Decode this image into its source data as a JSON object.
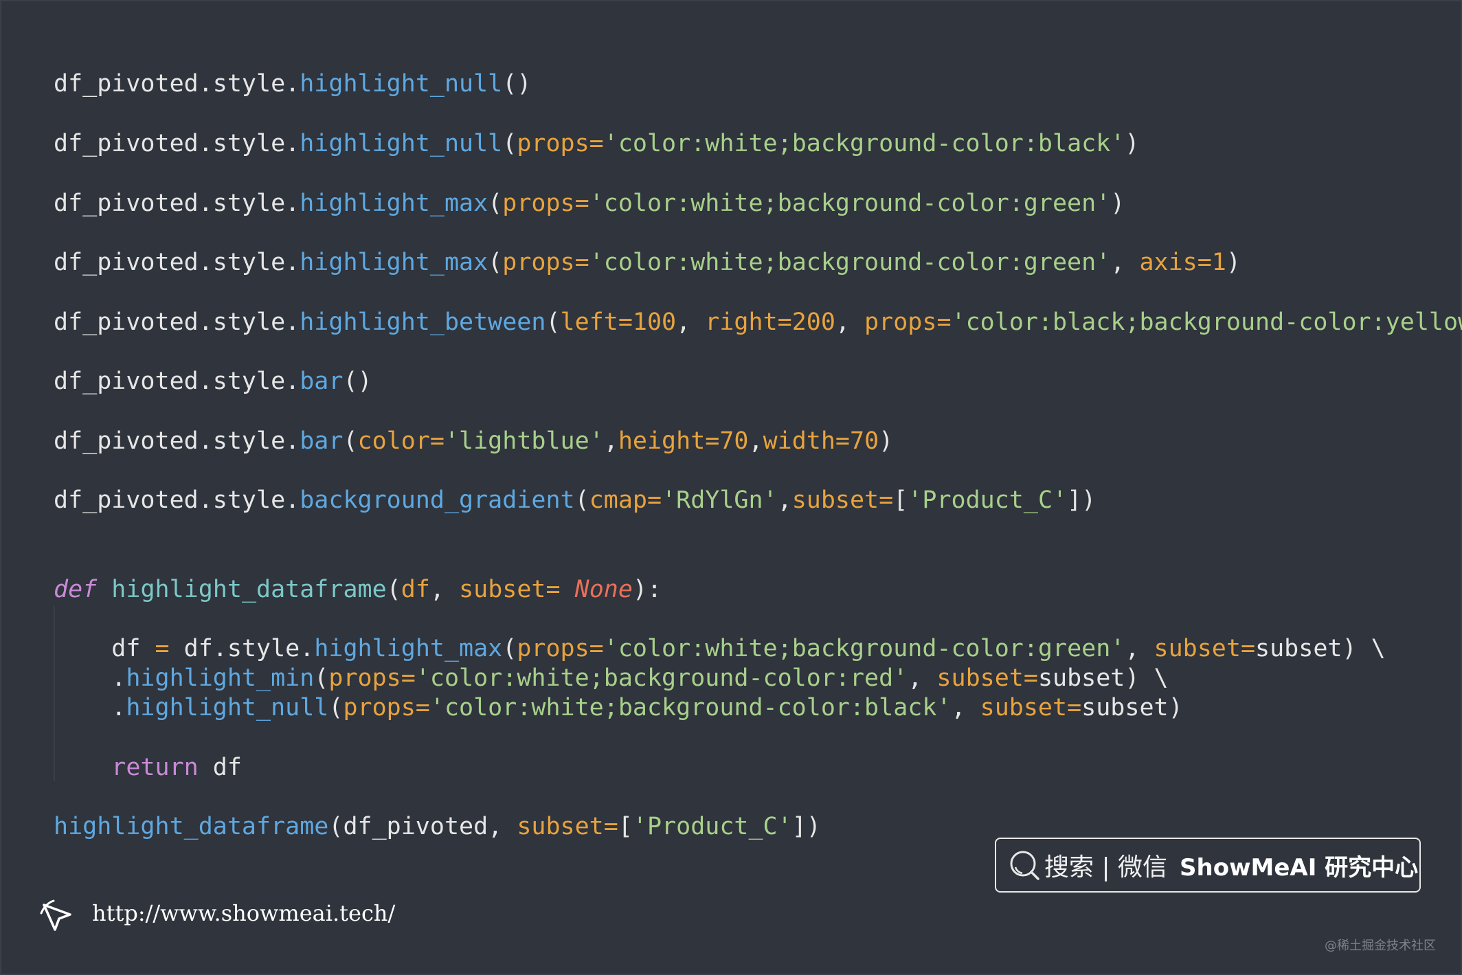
{
  "code_lines": [
    [
      {
        "t": "df_pivoted.style.",
        "c": "plain"
      },
      {
        "t": "highlight_null",
        "c": "fn"
      },
      {
        "t": "()",
        "c": "plain"
      }
    ],
    [
      {
        "t": "df_pivoted.style.",
        "c": "plain"
      },
      {
        "t": "highlight_null",
        "c": "fn"
      },
      {
        "t": "(",
        "c": "plain"
      },
      {
        "t": "props=",
        "c": "param"
      },
      {
        "t": "'color:white;background-color:black'",
        "c": "str"
      },
      {
        "t": ")",
        "c": "plain"
      }
    ],
    [
      {
        "t": "df_pivoted.style.",
        "c": "plain"
      },
      {
        "t": "highlight_max",
        "c": "fn"
      },
      {
        "t": "(",
        "c": "plain"
      },
      {
        "t": "props=",
        "c": "param"
      },
      {
        "t": "'color:white;background-color:green'",
        "c": "str"
      },
      {
        "t": ")",
        "c": "plain"
      }
    ],
    [
      {
        "t": "df_pivoted.style.",
        "c": "plain"
      },
      {
        "t": "highlight_max",
        "c": "fn"
      },
      {
        "t": "(",
        "c": "plain"
      },
      {
        "t": "props=",
        "c": "param"
      },
      {
        "t": "'color:white;background-color:green'",
        "c": "str"
      },
      {
        "t": ", ",
        "c": "plain"
      },
      {
        "t": "axis=1",
        "c": "param"
      },
      {
        "t": ")",
        "c": "plain"
      }
    ],
    [
      {
        "t": "df_pivoted.style.",
        "c": "plain"
      },
      {
        "t": "highlight_between",
        "c": "fn"
      },
      {
        "t": "(",
        "c": "plain"
      },
      {
        "t": "left=100",
        "c": "param"
      },
      {
        "t": ", ",
        "c": "plain"
      },
      {
        "t": "right=200",
        "c": "param"
      },
      {
        "t": ", ",
        "c": "plain"
      },
      {
        "t": "props=",
        "c": "param"
      },
      {
        "t": "'color:black;background-color:yellow'",
        "c": "str"
      },
      {
        "t": ")",
        "c": "plain"
      }
    ],
    [
      {
        "t": "df_pivoted.style.",
        "c": "plain"
      },
      {
        "t": "bar",
        "c": "fn"
      },
      {
        "t": "()",
        "c": "plain"
      }
    ],
    [
      {
        "t": "df_pivoted.style.",
        "c": "plain"
      },
      {
        "t": "bar",
        "c": "fn"
      },
      {
        "t": "(",
        "c": "plain"
      },
      {
        "t": "color=",
        "c": "param"
      },
      {
        "t": "'lightblue'",
        "c": "str"
      },
      {
        "t": ",",
        "c": "plain"
      },
      {
        "t": "height=70",
        "c": "param"
      },
      {
        "t": ",",
        "c": "plain"
      },
      {
        "t": "width=70",
        "c": "param"
      },
      {
        "t": ")",
        "c": "plain"
      }
    ],
    [
      {
        "t": "df_pivoted.style.",
        "c": "plain"
      },
      {
        "t": "background_gradient",
        "c": "fn"
      },
      {
        "t": "(",
        "c": "plain"
      },
      {
        "t": "cmap=",
        "c": "param"
      },
      {
        "t": "'RdYlGn'",
        "c": "str"
      },
      {
        "t": ",",
        "c": "plain"
      },
      {
        "t": "subset=",
        "c": "param"
      },
      {
        "t": "[",
        "c": "plain"
      },
      {
        "t": "'Product_C'",
        "c": "str"
      },
      {
        "t": "])",
        "c": "plain"
      }
    ],
    [
      {
        "t": "def",
        "c": "kw"
      },
      {
        "t": " ",
        "c": "plain"
      },
      {
        "t": "highlight_dataframe",
        "c": "def"
      },
      {
        "t": "(",
        "c": "plain"
      },
      {
        "t": "df",
        "c": "param"
      },
      {
        "t": ", ",
        "c": "plain"
      },
      {
        "t": "subset=",
        "c": "param"
      },
      {
        "t": " ",
        "c": "plain"
      },
      {
        "t": "None",
        "c": "none"
      },
      {
        "t": "):",
        "c": "plain"
      }
    ],
    [
      {
        "t": "    df ",
        "c": "plain"
      },
      {
        "t": "=",
        "c": "param"
      },
      {
        "t": " df.style.",
        "c": "plain"
      },
      {
        "t": "highlight_max",
        "c": "fn"
      },
      {
        "t": "(",
        "c": "plain"
      },
      {
        "t": "props=",
        "c": "param"
      },
      {
        "t": "'color:white;background-color:green'",
        "c": "str"
      },
      {
        "t": ", ",
        "c": "plain"
      },
      {
        "t": "subset=",
        "c": "param"
      },
      {
        "t": "subset) \\",
        "c": "plain"
      }
    ],
    [
      {
        "t": "    .",
        "c": "plain"
      },
      {
        "t": "highlight_min",
        "c": "fn"
      },
      {
        "t": "(",
        "c": "plain"
      },
      {
        "t": "props=",
        "c": "param"
      },
      {
        "t": "'color:white;background-color:red'",
        "c": "str"
      },
      {
        "t": ", ",
        "c": "plain"
      },
      {
        "t": "subset=",
        "c": "param"
      },
      {
        "t": "subset) \\",
        "c": "plain"
      }
    ],
    [
      {
        "t": "    .",
        "c": "plain"
      },
      {
        "t": "highlight_null",
        "c": "fn"
      },
      {
        "t": "(",
        "c": "plain"
      },
      {
        "t": "props=",
        "c": "param"
      },
      {
        "t": "'color:white;background-color:black'",
        "c": "str"
      },
      {
        "t": ", ",
        "c": "plain"
      },
      {
        "t": "subset=",
        "c": "param"
      },
      {
        "t": "subset)",
        "c": "plain"
      }
    ],
    [
      {
        "t": "    ",
        "c": "plain"
      },
      {
        "t": "return",
        "c": "ret"
      },
      {
        "t": " df",
        "c": "plain"
      }
    ],
    [
      {
        "t": "highlight_dataframe",
        "c": "fn"
      },
      {
        "t": "(df_pivoted, ",
        "c": "plain"
      },
      {
        "t": "subset=",
        "c": "param"
      },
      {
        "t": "[",
        "c": "plain"
      },
      {
        "t": "'Product_C'",
        "c": "str"
      },
      {
        "t": "])",
        "c": "plain"
      }
    ]
  ],
  "search_box": {
    "text": "搜索 | 微信",
    "brand": "ShowMeAI 研究中心"
  },
  "footer": {
    "url": "http://www.showmeai.tech/"
  },
  "watermark": "@稀土掘金技术社区",
  "colors": {
    "background": "#2f343d",
    "plain": "#e6e6e6",
    "function": "#5fa8e0",
    "parameter": "#e8a33d",
    "string": "#a8d08a",
    "keyword": "#c98ad6",
    "none": "#e8705a"
  }
}
